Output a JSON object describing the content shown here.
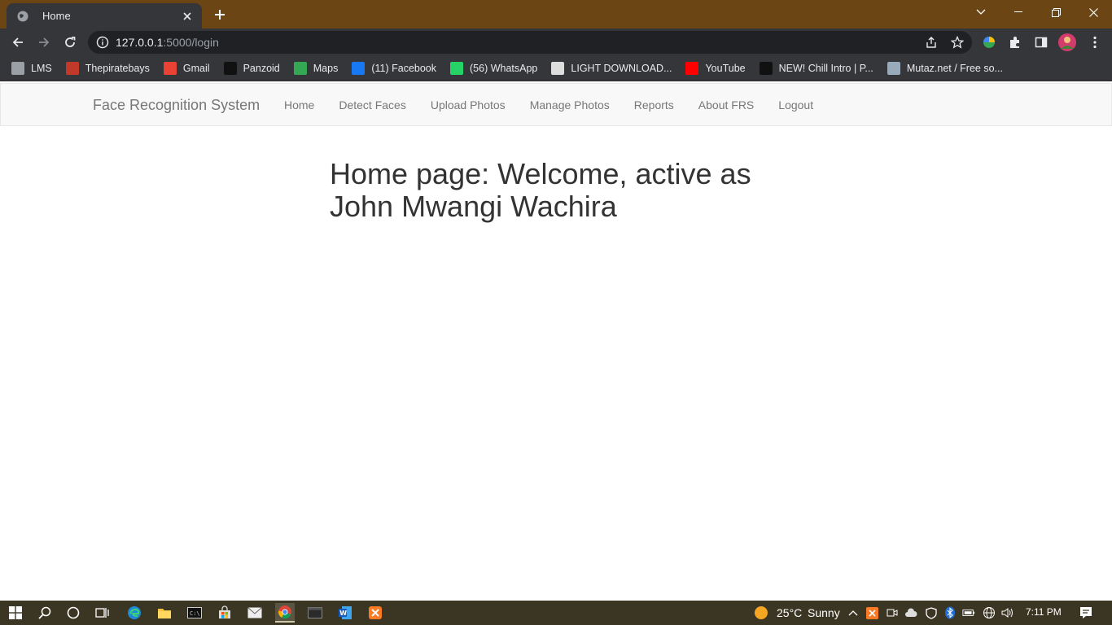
{
  "browser": {
    "tab_title": "Home",
    "url_host": "127.0.0.1",
    "url_rest": ":5000/login"
  },
  "bookmarks": [
    {
      "label": "LMS",
      "icon": "lms-icon",
      "color": "#9aa0a6"
    },
    {
      "label": "Thepiratebays",
      "icon": "pirate-icon",
      "color": "#c0392b"
    },
    {
      "label": "Gmail",
      "icon": "gmail-icon",
      "color": "#ea4335"
    },
    {
      "label": "Panzoid",
      "icon": "panzoid-icon",
      "color": "#111111"
    },
    {
      "label": "Maps",
      "icon": "maps-icon",
      "color": "#34a853"
    },
    {
      "label": "(11) Facebook",
      "icon": "facebook-icon",
      "color": "#1877f2"
    },
    {
      "label": "(56) WhatsApp",
      "icon": "whatsapp-icon",
      "color": "#25d366"
    },
    {
      "label": "LIGHT DOWNLOAD...",
      "icon": "download-icon",
      "color": "#dddddd"
    },
    {
      "label": "YouTube",
      "icon": "youtube-icon",
      "color": "#ff0000"
    },
    {
      "label": "NEW! Chill Intro | P...",
      "icon": "panzoid-icon",
      "color": "#111111"
    },
    {
      "label": "Mutaz.net / Free so...",
      "icon": "mutaz-icon",
      "color": "#9ab"
    }
  ],
  "navbar": {
    "brand": "Face Recognition System",
    "links": [
      "Home",
      "Detect Faces",
      "Upload Photos",
      "Manage Photos",
      "Reports",
      "About FRS",
      "Logout"
    ]
  },
  "main": {
    "heading": "Home page: Welcome, active as John Mwangi Wachira"
  },
  "taskbar": {
    "weather_temp": "25°C",
    "weather_desc": "Sunny",
    "time": "7:11 PM"
  },
  "colors": {
    "titlebar": "#6b4513",
    "toolbar": "#35363a",
    "taskbar": "#3b3624",
    "navbar": "#f8f8f8"
  }
}
